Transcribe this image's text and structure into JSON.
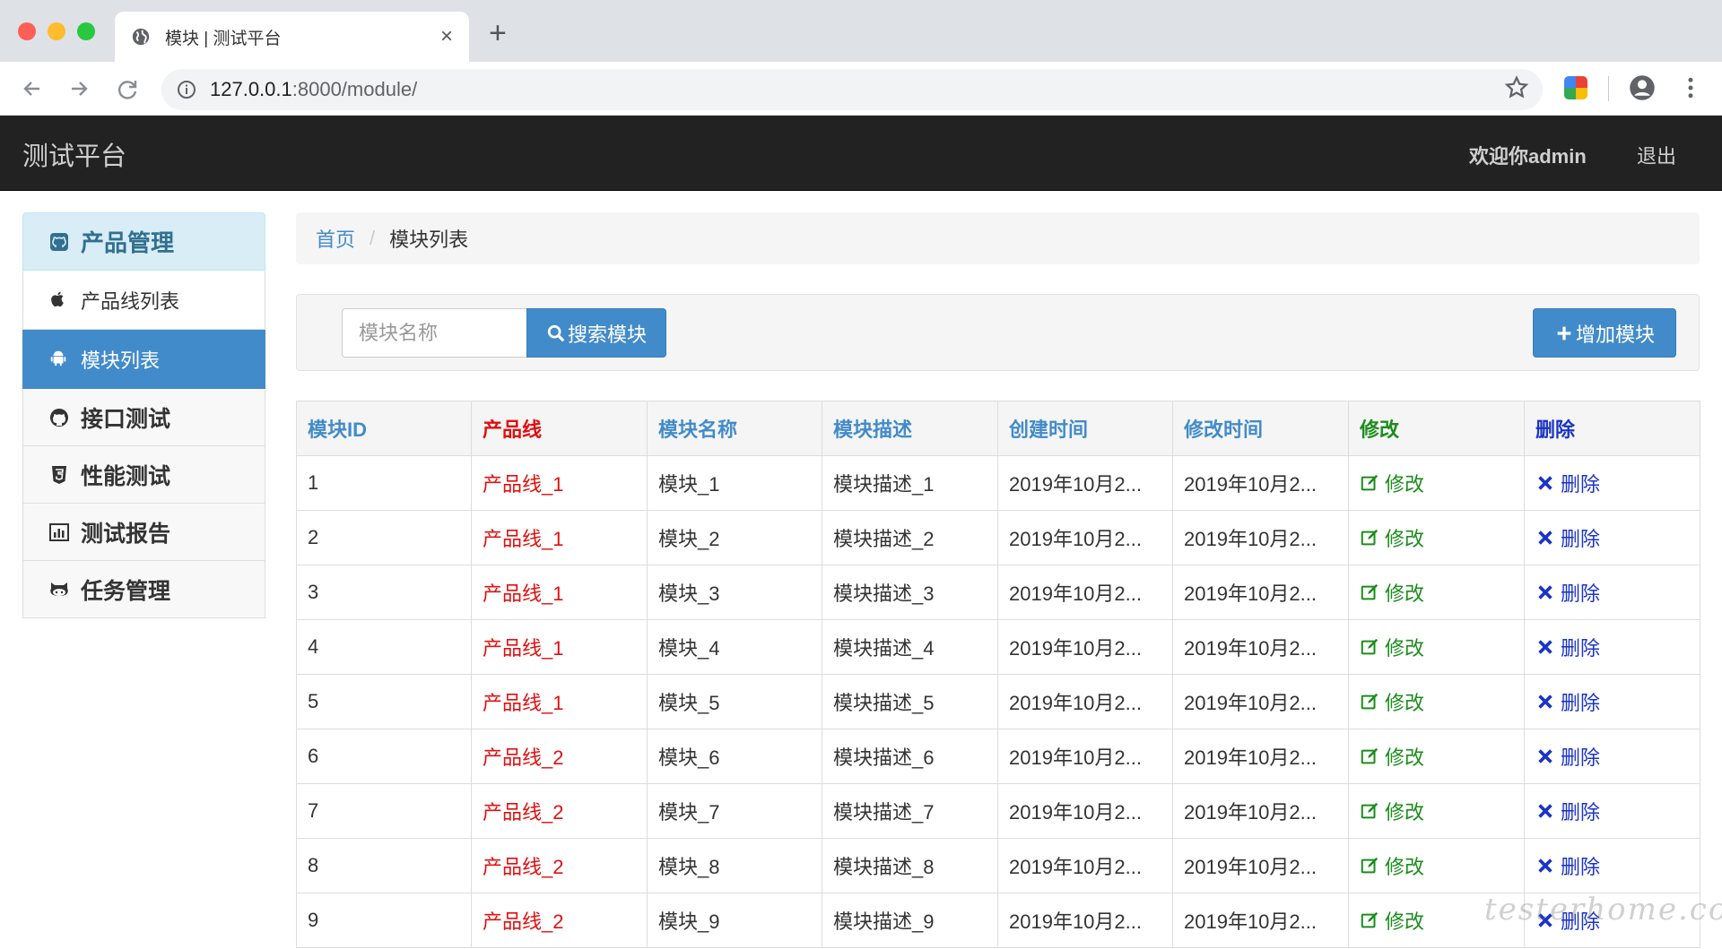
{
  "browser": {
    "tab_title": "模块 | 测试平台",
    "tab_close": "×",
    "new_tab": "+",
    "url_host": "127.0.0.1",
    "url_rest": ":8000/module/"
  },
  "navbar": {
    "brand": "测试平台",
    "welcome": "欢迎你admin",
    "logout": "退出"
  },
  "sidebar": {
    "header": {
      "label": "产品管理",
      "icon": "github-icon"
    },
    "items": [
      {
        "label": "产品线列表",
        "icon": "apple-icon",
        "active": false
      },
      {
        "label": "模块列表",
        "icon": "android-icon",
        "active": true
      },
      {
        "label": "接口测试",
        "icon": "github-icon",
        "active": false
      },
      {
        "label": "性能测试",
        "icon": "html5-icon",
        "active": false
      },
      {
        "label": "测试报告",
        "icon": "bar-chart-icon",
        "active": false
      },
      {
        "label": "任务管理",
        "icon": "octocat-icon",
        "active": false
      }
    ]
  },
  "breadcrumb": {
    "home": "首页",
    "separator": "/",
    "current": "模块列表"
  },
  "search": {
    "placeholder": "模块名称",
    "button_label": "搜索模块",
    "add_label": "增加模块"
  },
  "table": {
    "headers": [
      "模块ID",
      "产品线",
      "模块名称",
      "模块描述",
      "创建时间",
      "修改时间",
      "修改",
      "删除"
    ],
    "rows": [
      {
        "id": "1",
        "line": "产品线_1",
        "name": "模块_1",
        "desc": "模块描述_1",
        "created": "2019年10月2...",
        "modified": "2019年10月2...",
        "edit": "修改",
        "del": "删除"
      },
      {
        "id": "2",
        "line": "产品线_1",
        "name": "模块_2",
        "desc": "模块描述_2",
        "created": "2019年10月2...",
        "modified": "2019年10月2...",
        "edit": "修改",
        "del": "删除"
      },
      {
        "id": "3",
        "line": "产品线_1",
        "name": "模块_3",
        "desc": "模块描述_3",
        "created": "2019年10月2...",
        "modified": "2019年10月2...",
        "edit": "修改",
        "del": "删除"
      },
      {
        "id": "4",
        "line": "产品线_1",
        "name": "模块_4",
        "desc": "模块描述_4",
        "created": "2019年10月2...",
        "modified": "2019年10月2...",
        "edit": "修改",
        "del": "删除"
      },
      {
        "id": "5",
        "line": "产品线_1",
        "name": "模块_5",
        "desc": "模块描述_5",
        "created": "2019年10月2...",
        "modified": "2019年10月2...",
        "edit": "修改",
        "del": "删除"
      },
      {
        "id": "6",
        "line": "产品线_2",
        "name": "模块_6",
        "desc": "模块描述_6",
        "created": "2019年10月2...",
        "modified": "2019年10月2...",
        "edit": "修改",
        "del": "删除"
      },
      {
        "id": "7",
        "line": "产品线_2",
        "name": "模块_7",
        "desc": "模块描述_7",
        "created": "2019年10月2...",
        "modified": "2019年10月2...",
        "edit": "修改",
        "del": "删除"
      },
      {
        "id": "8",
        "line": "产品线_2",
        "name": "模块_8",
        "desc": "模块描述_8",
        "created": "2019年10月2...",
        "modified": "2019年10月2...",
        "edit": "修改",
        "del": "删除"
      },
      {
        "id": "9",
        "line": "产品线_2",
        "name": "模块_9",
        "desc": "模块描述_9",
        "created": "2019年10月2...",
        "modified": "2019年10月2...",
        "edit": "修改",
        "del": "删除"
      }
    ]
  },
  "watermark": "testerhome.com",
  "colors": {
    "primary": "#428bca",
    "navbar_bg": "#222222",
    "product_line_red": "#e01010",
    "edit_green": "#1c8c1c",
    "delete_blue": "#1a33c8"
  }
}
